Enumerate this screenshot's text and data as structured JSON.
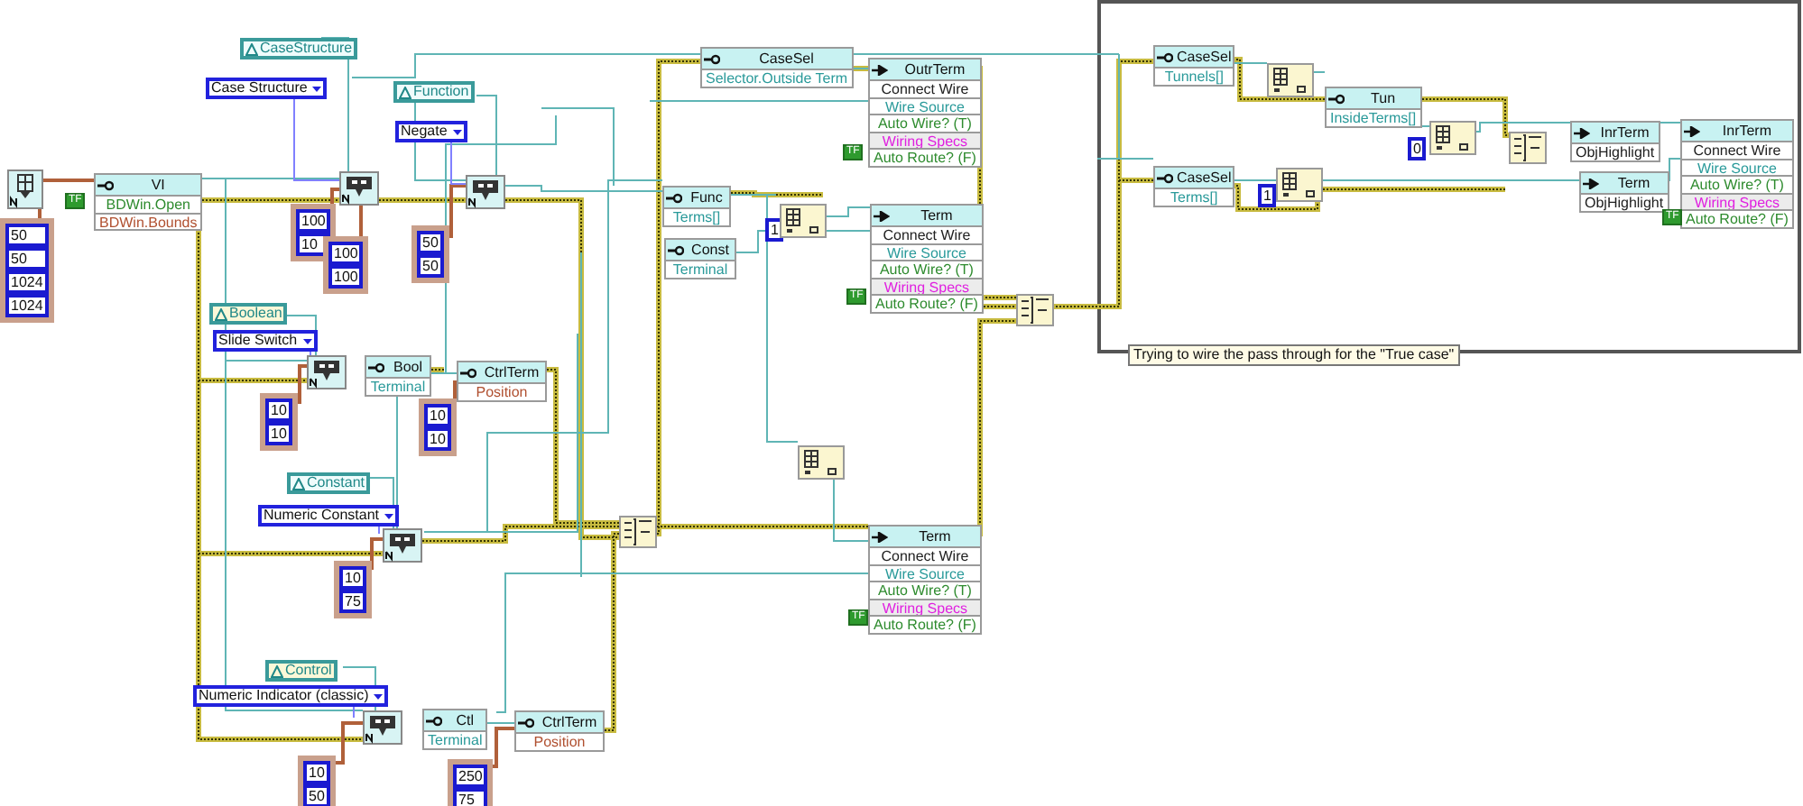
{
  "diagram": {
    "property_nodes": [
      {
        "kind": "property",
        "title": "VI",
        "rows": [
          {
            "text": "BDWin.Open",
            "kind": "boolean"
          },
          {
            "text": "BDWin.Bounds",
            "kind": "cluster"
          }
        ]
      },
      {
        "kind": "property",
        "title": "CaseSel",
        "rows": [
          {
            "text": "Selector.Outside Term",
            "kind": "reference"
          }
        ]
      },
      {
        "kind": "invoke",
        "title": "OutrTerm",
        "rows": [
          {
            "text": "Connect Wire",
            "kind": "method"
          },
          {
            "text": "Wire Source",
            "kind": "reference"
          },
          {
            "text": "Auto Wire? (T)",
            "kind": "boolean"
          },
          {
            "text": "Wiring Specs",
            "kind": "specs"
          },
          {
            "text": "Auto Route? (F)",
            "kind": "boolean"
          }
        ]
      },
      {
        "kind": "property",
        "title": "Func",
        "rows": [
          {
            "text": "Terms[]",
            "kind": "reference"
          }
        ]
      },
      {
        "kind": "property",
        "title": "Const",
        "rows": [
          {
            "text": "Terminal",
            "kind": "reference"
          }
        ]
      },
      {
        "kind": "invoke",
        "title": "Term",
        "rows": [
          {
            "text": "Connect Wire",
            "kind": "method"
          },
          {
            "text": "Wire Source",
            "kind": "reference"
          },
          {
            "text": "Auto Wire? (T)",
            "kind": "boolean"
          },
          {
            "text": "Wiring Specs",
            "kind": "specs"
          },
          {
            "text": "Auto Route? (F)",
            "kind": "boolean"
          }
        ]
      },
      {
        "kind": "property",
        "title": "Bool",
        "rows": [
          {
            "text": "Terminal",
            "kind": "reference"
          }
        ]
      },
      {
        "kind": "property",
        "title": "CtrlTerm",
        "rows": [
          {
            "text": "Position",
            "kind": "cluster"
          }
        ]
      },
      {
        "kind": "invoke",
        "title": "Term",
        "rows": [
          {
            "text": "Connect Wire",
            "kind": "method"
          },
          {
            "text": "Wire Source",
            "kind": "reference"
          },
          {
            "text": "Auto Wire? (T)",
            "kind": "boolean"
          },
          {
            "text": "Wiring Specs",
            "kind": "specs"
          },
          {
            "text": "Auto Route? (F)",
            "kind": "boolean"
          }
        ]
      },
      {
        "kind": "property",
        "title": "Ctl",
        "rows": [
          {
            "text": "Terminal",
            "kind": "reference"
          }
        ]
      },
      {
        "kind": "property",
        "title": "CtrlTerm",
        "rows": [
          {
            "text": "Position",
            "kind": "cluster"
          }
        ]
      },
      {
        "kind": "property",
        "title": "CaseSel",
        "rows": [
          {
            "text": "Tunnels[]",
            "kind": "reference"
          }
        ]
      },
      {
        "kind": "property",
        "title": "Tun",
        "rows": [
          {
            "text": "InsideTerms[]",
            "kind": "reference"
          }
        ]
      },
      {
        "kind": "property",
        "title": "CaseSel",
        "rows": [
          {
            "text": "Terms[]",
            "kind": "reference"
          }
        ]
      },
      {
        "kind": "invoke",
        "title": "InrTerm",
        "rows": [
          {
            "text": "ObjHighlight",
            "kind": "method"
          }
        ]
      },
      {
        "kind": "invoke",
        "title": "Term",
        "rows": [
          {
            "text": "ObjHighlight",
            "kind": "method"
          }
        ]
      },
      {
        "kind": "invoke",
        "title": "InrTerm",
        "rows": [
          {
            "text": "Connect Wire",
            "kind": "method"
          },
          {
            "text": "Wire Source",
            "kind": "reference"
          },
          {
            "text": "Auto Wire? (T)",
            "kind": "boolean"
          },
          {
            "text": "Wiring Specs",
            "kind": "specs"
          },
          {
            "text": "Auto Route? (F)",
            "kind": "boolean"
          }
        ]
      }
    ],
    "class_constants": [
      {
        "label": "CaseStructure",
        "highlighted": false
      },
      {
        "label": "Function",
        "highlighted": false
      },
      {
        "label": "Boolean",
        "highlighted": true
      },
      {
        "label": "Constant",
        "highlighted": false
      },
      {
        "label": "Control",
        "highlighted": true
      }
    ],
    "rings": [
      {
        "label": "Case Structure"
      },
      {
        "label": "Negate"
      },
      {
        "label": "Slide Switch"
      },
      {
        "label": "Numeric Constant"
      },
      {
        "label": "Numeric Indicator (classic)"
      }
    ],
    "numeric_clusters": [
      {
        "values": [
          "50",
          "50",
          "1024",
          "1024"
        ]
      },
      {
        "values": [
          "100",
          "10"
        ]
      },
      {
        "values": [
          "100",
          "100"
        ]
      },
      {
        "values": [
          "50",
          "50"
        ]
      },
      {
        "values": [
          "10",
          "10"
        ]
      },
      {
        "values": [
          "10",
          "10"
        ]
      },
      {
        "values": [
          "10",
          "75"
        ]
      },
      {
        "values": [
          "10",
          "50"
        ]
      },
      {
        "values": [
          "250",
          "75"
        ]
      }
    ],
    "numeric_constants": [
      "1",
      "0",
      "1"
    ],
    "boolean_constants": [
      "TF",
      "TF",
      "TF",
      "TF",
      "TF"
    ],
    "case_structure": {
      "comment": "Trying to wire the pass through for the \"True case\""
    }
  }
}
